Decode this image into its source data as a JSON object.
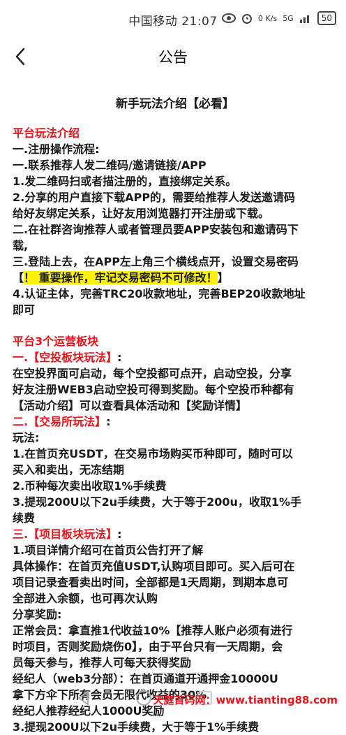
{
  "status": {
    "carrier_time": "中国移动 21:07",
    "network": "5G",
    "speed": "0 K/s",
    "battery": "50"
  },
  "nav": {
    "title": "公告"
  },
  "article": {
    "title": "新手玩法介绍【必看】",
    "s1_heading": "平台玩法介绍",
    "l1": "一.注册操作流程:",
    "l2": "一.联系推荐人发二维码/邀请链接/APP",
    "l3": "1.发二维码扫或者描注册的，直接绑定关系。",
    "l4": "2.分享的用户直接下载APP的，需要给推荐人发送邀请码",
    "l5": "给好友绑定关系，让好友用浏览器打开注册或下载。",
    "l6": "二.在社群咨询推荐人或者管理员要APP安装包和邀请码下",
    "l7": "载,",
    "l8": "三.登陆上去，在APP左上角三个横线点开，设置交易密码",
    "l9_bracket_open": "【",
    "l9_highlight": "！ 重要操作，牢记交易密码不可修改！",
    "l9_bracket_close": "】",
    "l10": "4.认证主体，完善TRC20收款地址，完善BEP20收款地址",
    "l11": "即可",
    "s2_heading": "平台3个运营板块",
    "s2a_heading": "一.【空投板块玩法】",
    "s2a_colon": ":",
    "l12": "在空投界面可启动，每个空投都可点开，启动空投，分享",
    "l13": "好友注册WEB3启动空投可得到奖励。每个空投币种都有",
    "l14": "【活动介绍】可以查看具体活动和【奖励详情】",
    "s2b_heading": "二.【交易所玩法】",
    "s2b_colon": ":",
    "l15": "玩法:",
    "l16": "1.在首页充USDT，在交易市场购买币种即可，随时可以",
    "l17": "买入和卖出，无冻结期",
    "l18": "2.币种每次卖出收取1%手续费",
    "l19": "3.提现200U以下2u手续费，大于等于200u，收取1%手",
    "l20": "续费",
    "s2c_heading": "三.【项目板块玩法】",
    "s2c_colon": ":",
    "l21": "1.项目详情介绍可在首页公告打开了解",
    "l22": "具体操作：在首页充值USDT,认购项目即可。买入后可在",
    "l23": "项目记录查看卖出时间，全部都是1天周期，到期本息可",
    "l24": "全部进入余额，也可再次认购",
    "l25": "分享奖励:",
    "l26": "正常会员：拿直推1代收益10%【推荐人账户必须有进行",
    "l27": "时项目，否则奖励烧伤0】，由于平台只有一天周期，会",
    "l28": "员每天参与，推荐人可每天获得奖励",
    "l29": "经纪人（web3分部）：在首页通道开通押金10000U",
    "l30": "拿下方伞下所有会员无限代收益的30%",
    "l31": "经纪人推荐经纪人1000U奖励",
    "l32": "3.提现200U以下2u手续费，大于等于1%手续费"
  },
  "watermark": "天庭首码网：www.tianting88.com"
}
